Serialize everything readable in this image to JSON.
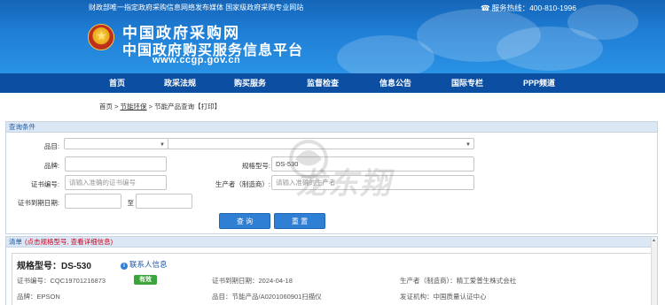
{
  "header": {
    "notice": "财政部唯一指定政府采购信息网络发布媒体 国家级政府采购专业网站",
    "hotline": "服务热线：400-810-1996",
    "site_name": "中国政府采购网",
    "site_sub": "中国政府购买服务信息平台",
    "site_url": "www.ccgp.gov.cn"
  },
  "nav": {
    "items": [
      {
        "label": "首页"
      },
      {
        "label": "政采法规"
      },
      {
        "label": "购买服务"
      },
      {
        "label": "监督检查"
      },
      {
        "label": "信息公告"
      },
      {
        "label": "国际专栏"
      },
      {
        "label": "PPP频道"
      }
    ]
  },
  "breadcrumb": {
    "home": "首页",
    "sep1": " > ",
    "section": "节能环保",
    "sep2": " > ",
    "page": "节能产品查询",
    "print": "【打印】"
  },
  "query": {
    "title": "查询条件",
    "category_label": "品目:",
    "brand_label": "品牌:",
    "model_label": "规格型号:",
    "model_value": "DS-530",
    "cert_label": "证书编号:",
    "cert_placeholder": "请输入准确的证书编号",
    "maker_label": "生产者（制造商）:",
    "maker_placeholder": "请输入准确的生产者",
    "expiry_label": "证书到期日期:",
    "to_label": "至",
    "search_button": "查 询",
    "reset_button": "重 置"
  },
  "watermark": "龙东翔",
  "list": {
    "title": "清单",
    "note": "(点击规格型号, 查看详细信息)",
    "items": [
      {
        "model": "规格型号：DS-530",
        "contact": "联系人信息",
        "cert_no": "证书编号：CQC19701216873",
        "status": "有效",
        "expiry": "证书到期日期：2024-04-18",
        "maker": "生产者（制造商）：精工爱普生株式会社",
        "brand": "品牌：EPSON",
        "category": "品目：节能产品/A0201060901扫描仪",
        "issuer": "发证机构：中国质量认证中心"
      }
    ]
  },
  "colors": {
    "nav_bg": "#0c4fa2",
    "banner": "#1f7fd6",
    "panel_head": "#dbe7f5",
    "button": "#2f7fd4",
    "valid_badge": "#3aa53a",
    "note_red": "#d0021b"
  }
}
